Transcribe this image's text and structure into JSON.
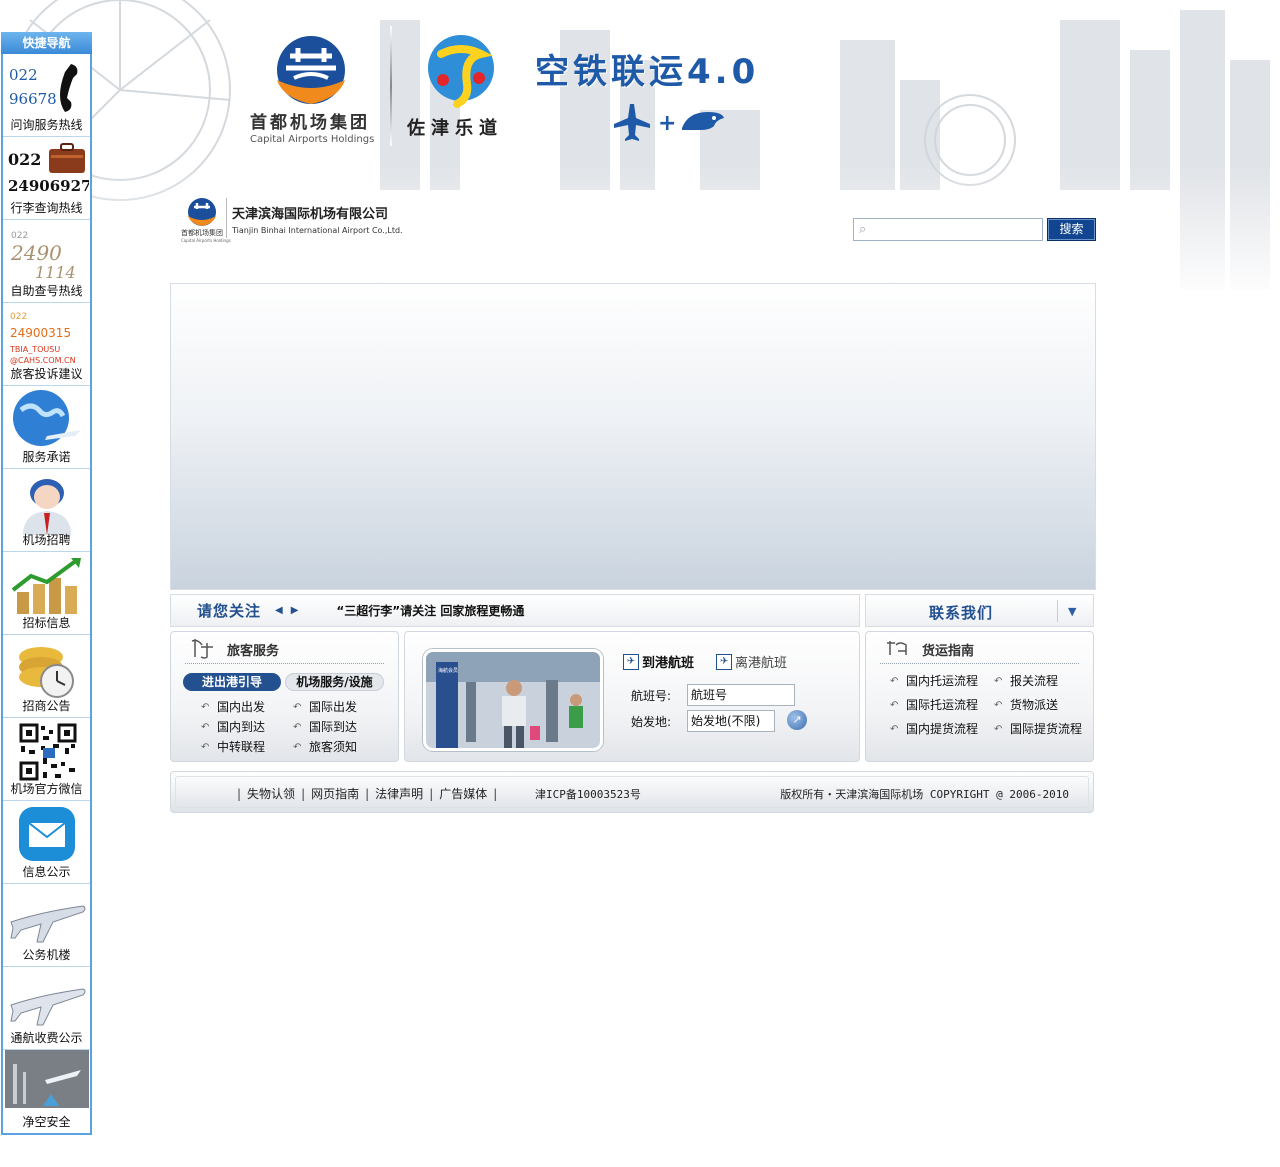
{
  "quicknav": {
    "title": "快捷导航",
    "items": [
      {
        "label": "问询服务热线",
        "lines": [
          "022",
          "96678"
        ],
        "icon": "phone-icon"
      },
      {
        "label": "行李查询热线",
        "lines": [
          "022",
          "24906927"
        ],
        "icon": "luggage-icon"
      },
      {
        "label": "自助查号热线",
        "lines": [
          "022",
          "2490",
          "1114"
        ],
        "icon": "self-service-number-icon"
      },
      {
        "label": "旅客投诉建议",
        "lines": [
          "022",
          "24900315",
          "TBIA_TOUSU",
          "@CAHS.COM.CN"
        ],
        "icon": "complaint-icon"
      },
      {
        "label": "服务承诺",
        "icon": "globe-plane-icon"
      },
      {
        "label": "机场招聘",
        "icon": "person-icon"
      },
      {
        "label": "招标信息",
        "icon": "growth-chart-icon"
      },
      {
        "label": "招商公告",
        "icon": "coins-clock-icon"
      },
      {
        "label": "机场官方微信",
        "icon": "qr-code-icon"
      },
      {
        "label": "信息公示",
        "icon": "mail-icon"
      },
      {
        "label": "公务机楼",
        "icon": "business-jet-icon"
      },
      {
        "label": "通航收费公示",
        "icon": "general-aviation-icon"
      },
      {
        "label": "净空安全",
        "icon": "clearance-safety-icon"
      }
    ]
  },
  "header": {
    "cah_name_cn": "首都机场集团",
    "cah_name_en": "Capital Airports Holdings",
    "tj_slogan": "佐津乐道",
    "headline": "空铁联运4.0",
    "headline_plus": "+"
  },
  "company": {
    "name_cn": "天津滨海国际机场有限公司",
    "name_en": "Tianjin Binhai International Airport Co.,Ltd.",
    "logo_caption_cn": "首都机场集团",
    "logo_caption_en": "Capital Airports Holdings"
  },
  "search": {
    "placeholder": "",
    "button_label": "搜索"
  },
  "notice": {
    "title": "请您关注",
    "text": "“三超行李”请关注 回家旅程更畅通"
  },
  "contact": {
    "title": "联系我们"
  },
  "passenger_panel": {
    "title": "旅客服务",
    "tabs": [
      "进出港引导",
      "机场服务/设施"
    ],
    "links": [
      "国内出发",
      "国际出发",
      "国内到达",
      "国际到达",
      "中转联程",
      "旅客须知"
    ]
  },
  "flight_panel": {
    "tabs": [
      "到港航班",
      "离港航班"
    ],
    "flight_no_label": "航班号:",
    "flight_no_value": "航班号",
    "origin_label": "始发地:",
    "origin_value": "始发地(不限)",
    "photo_sign_text": "海航会员"
  },
  "cargo_panel": {
    "title": "货运指南",
    "links": [
      "国内托运流程",
      "报关流程",
      "国际托运流程",
      "货物派送",
      "国内提货流程",
      "国际提货流程"
    ]
  },
  "footer": {
    "links": [
      "失物认领",
      "网页指南",
      "法律声明",
      "广告媒体"
    ],
    "icp": "津ICP备10003523号",
    "copyright": "版权所有・天津滨海国际机场 COPYRIGHT @ 2006-2010"
  },
  "colors": {
    "brand_blue": "#23508f",
    "headline_blue": "#1e5aa8",
    "nav_border": "#5aa3e0"
  }
}
